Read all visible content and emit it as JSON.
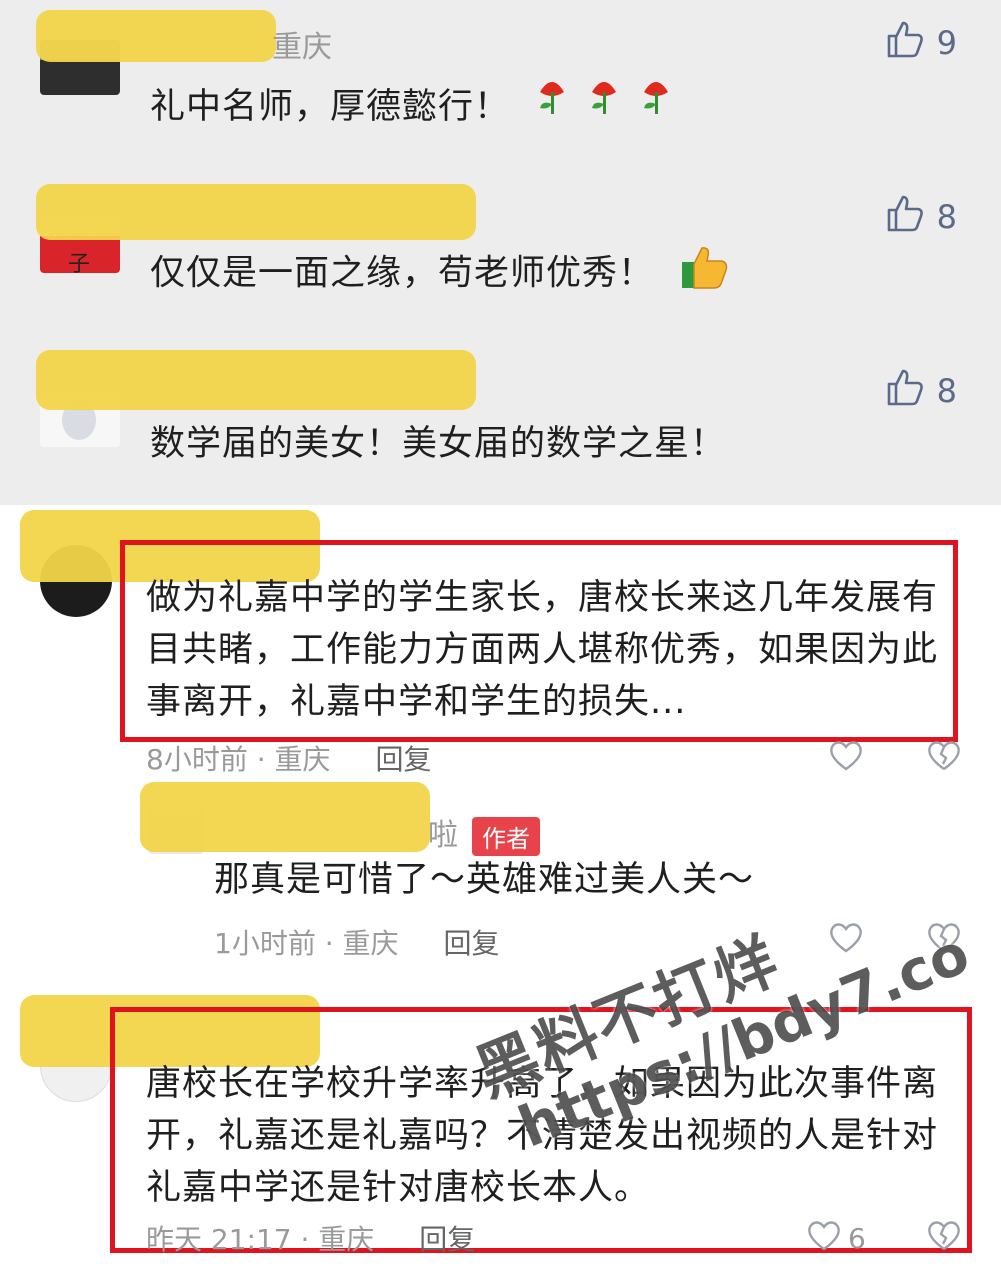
{
  "colors": {
    "top_bg": "#ededed",
    "highlight": "#f2d54a",
    "red_box": "#e0141e",
    "author_tag": "#e8424a",
    "like": "#5a6a8a"
  },
  "comments": [
    {
      "location": "重庆",
      "text": "礼中名师，厚德懿行！",
      "emoji": "rose-emoji x3",
      "likes": "9"
    },
    {
      "text": "仅仅是一面之缘，苟老师优秀！",
      "emoji": "thumbs-up-emoji",
      "likes": "8"
    },
    {
      "text": "数学届的美女！美女届的数学之星！",
      "likes": "8"
    }
  ],
  "threads": [
    {
      "text_lines": [
        "做为礼嘉中学的学生家长，唐校长来这几年发展有",
        "目共睹，工作能力方面两人堪称优秀，如果因为此",
        "事离开，礼嘉中学和学生的损失..."
      ],
      "meta_time": "8小时前 · 重庆",
      "reply_label": "回复",
      "reply": {
        "name_suffix": "啦",
        "author_tag": "作者",
        "text": "那真是可惜了～英雄难过美人关～",
        "meta_time": "1小时前 · 重庆",
        "reply_label": "回复"
      }
    },
    {
      "text_lines": [
        "唐校长在学校升学率升高了，如果因为此次事件离",
        "开，礼嘉还是礼嘉吗？不清楚发出视频的人是针对",
        "礼嘉中学还是针对唐校长本人。"
      ],
      "meta_time": "昨天 21:17 · 重庆",
      "reply_label": "回复",
      "likes": "6"
    }
  ],
  "watermark": {
    "line1": "黑料不打烊",
    "line2": "https://bdy7.co"
  }
}
